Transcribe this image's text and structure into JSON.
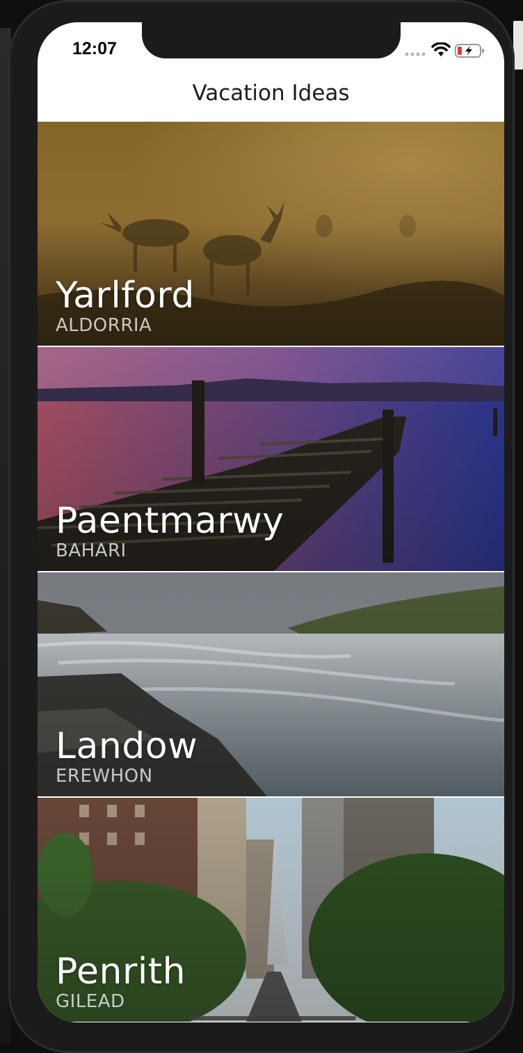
{
  "status_bar": {
    "time": "12:07"
  },
  "nav": {
    "title": "Vacation Ideas"
  },
  "destinations": [
    {
      "city": "Yarlford",
      "country": "ALDORRIA"
    },
    {
      "city": "Paentmarwy",
      "country": "BAHARI"
    },
    {
      "city": "Landow",
      "country": "EREWHON"
    },
    {
      "city": "Penrith",
      "country": "GILEAD"
    }
  ],
  "colors": {
    "nav_background": "#ffffff",
    "title_text": "#1c1c1c",
    "card_title": "#ffffff",
    "battery_low": "#e53935"
  },
  "icons": [
    "signal-icon",
    "wifi-icon",
    "battery-icon"
  ]
}
